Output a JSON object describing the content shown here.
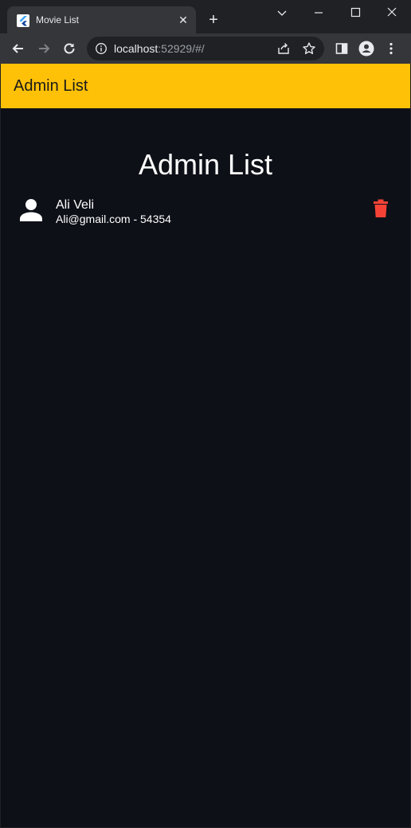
{
  "browser": {
    "tab": {
      "title": "Movie List",
      "favicon": "flutter-icon"
    },
    "url": {
      "host": "localhost",
      "rest": ":52929/#/"
    }
  },
  "app": {
    "appbar_title": "Admin List",
    "heading": "Admin List",
    "admins": [
      {
        "name": "Ali Veli",
        "email": "Ali@gmail.com",
        "phone": "54354",
        "subtitle": "Ali@gmail.com - 54354"
      }
    ]
  },
  "colors": {
    "accent": "#ffc107",
    "background": "#0d1017",
    "delete": "#f44336"
  }
}
